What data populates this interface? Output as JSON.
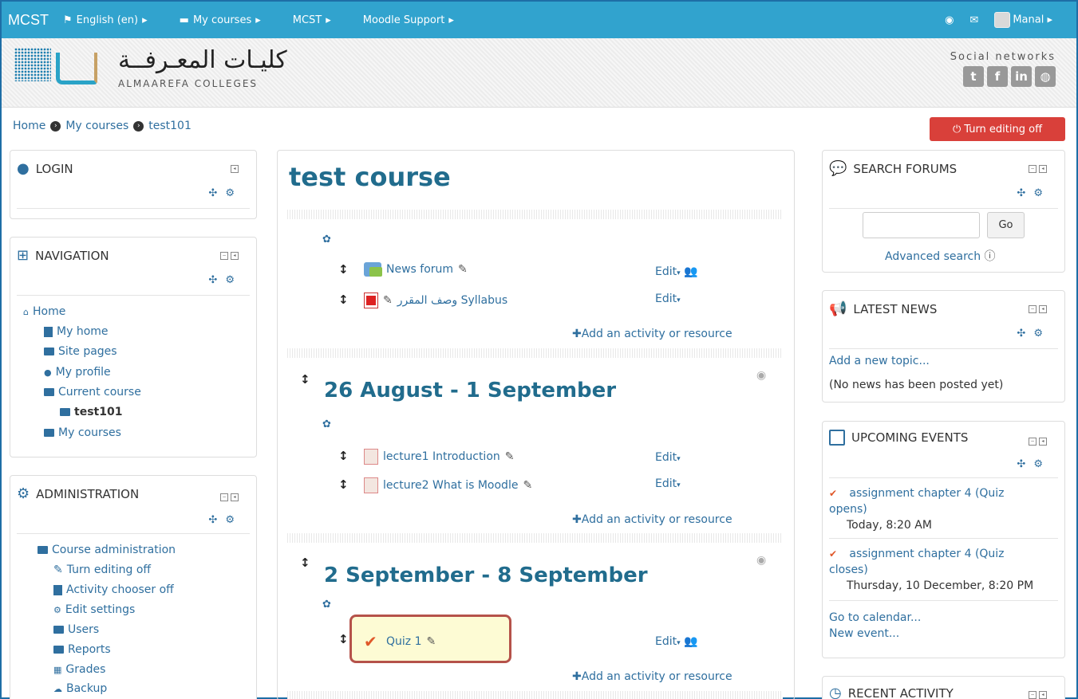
{
  "topbar": {
    "brand": "MCST",
    "language": "English (en)",
    "my_courses": "My courses",
    "mcst": "MCST",
    "support": "Moodle Support",
    "user": "Manal"
  },
  "header": {
    "logo_arabic": "كليـات المعـرفــة",
    "logo_english": "ALMAAREFA COLLEGES",
    "social_label": "Social networks",
    "social_icons": [
      "twitter-icon",
      "facebook-icon",
      "linkedin-icon",
      "dribbble-icon"
    ]
  },
  "breadcrumb": [
    "Home",
    "My courses",
    "test101"
  ],
  "edit_button": "Turn editing off",
  "login_block": {
    "title": "LOGIN"
  },
  "navigation_block": {
    "title": "NAVIGATION",
    "items": [
      "Home",
      "My home",
      "Site pages",
      "My profile",
      "Current course",
      "test101",
      "My courses"
    ]
  },
  "admin_block": {
    "title": "ADMINISTRATION",
    "items": [
      "Course administration",
      "Turn editing off",
      "Activity chooser off",
      "Edit settings",
      "Users",
      "Reports",
      "Grades",
      "Backup"
    ]
  },
  "course": {
    "title": "test course",
    "general": {
      "activities": [
        {
          "name": "News forum",
          "edit": "Edit"
        },
        {
          "name": "وصف المقرر Syllabus",
          "edit": "Edit"
        }
      ],
      "add": "Add an activity or resource"
    },
    "sections": [
      {
        "title": "26 August - 1 September",
        "activities": [
          {
            "name": "lecture1 Introduction",
            "edit": "Edit"
          },
          {
            "name": "lecture2 What is Moodle",
            "edit": "Edit"
          }
        ],
        "add": "Add an activity or resource"
      },
      {
        "title": "2 September - 8 September",
        "activities": [
          {
            "name": "Quiz 1",
            "edit": "Edit"
          }
        ],
        "add": "Add an activity or resource"
      }
    ]
  },
  "search_block": {
    "title": "SEARCH FORUMS",
    "go": "Go",
    "advanced": "Advanced search"
  },
  "news_block": {
    "title": "LATEST NEWS",
    "add": "Add a new topic...",
    "empty": "(No news has been posted yet)"
  },
  "events_block": {
    "title": "UPCOMING EVENTS",
    "events": [
      {
        "name": "assignment chapter 4 (Quiz",
        "name2": "opens)",
        "date": "Today, 8:20 AM"
      },
      {
        "name": "assignment chapter 4 (Quiz",
        "name2": "closes)",
        "date": "Thursday, 10 December, 8:20 PM"
      }
    ],
    "calendar": "Go to calendar...",
    "new_event": "New event..."
  },
  "recent_block": {
    "title": "RECENT ACTIVITY"
  }
}
